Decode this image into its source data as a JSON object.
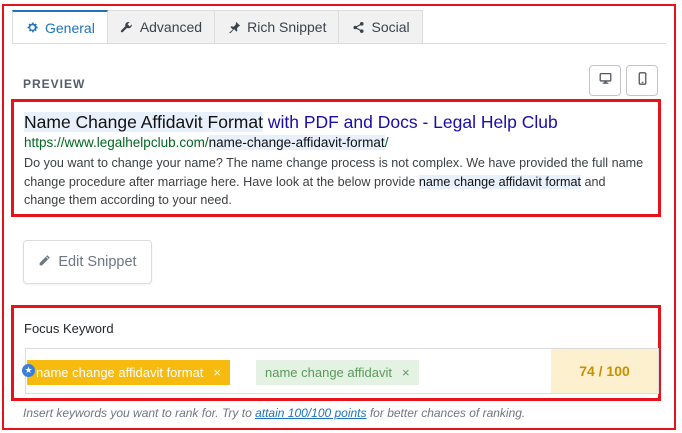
{
  "tabs": [
    {
      "label": "General",
      "icon": "gear-icon",
      "active": true
    },
    {
      "label": "Advanced",
      "icon": "wrench-icon",
      "active": false
    },
    {
      "label": "Rich Snippet",
      "icon": "pin-icon",
      "active": false
    },
    {
      "label": "Social",
      "icon": "share-icon",
      "active": false
    }
  ],
  "preview": {
    "label": "PREVIEW",
    "title_highlight": "Name Change Affidavit Format",
    "title_rest": " with PDF and Docs - Legal Help Club",
    "url_base": "https://www.legalhelpclub.com/",
    "url_slug": "name-change-affidavit-format",
    "url_trailing": "/",
    "desc_before": "Do you want to change your name? The name change process is not complex. We have provided the full name change procedure after marriage here. Have look at the below provide ",
    "desc_keyword": "name change affidavit format",
    "desc_after": " and change them according to your need.",
    "device_buttons": [
      "desktop-icon",
      "mobile-icon"
    ]
  },
  "edit_snippet": {
    "label": "Edit Snippet",
    "icon": "pencil-icon"
  },
  "focus_keyword": {
    "label": "Focus Keyword",
    "keywords": [
      {
        "text": "name change affidavit format",
        "primary": true,
        "remove": "×"
      },
      {
        "text": "name change affidavit",
        "primary": false,
        "remove": "×"
      }
    ],
    "score": "74 / 100"
  },
  "hint": {
    "before": "Insert keywords you want to rank for. Try to ",
    "link": "attain 100/100 points",
    "after": " for better chances of ranking."
  },
  "colors": {
    "accent": "#1e73be",
    "highlight_frame": "#e8121b",
    "primary_keyword": "#f7ba0f",
    "secondary_keyword": "#e4f2e4",
    "score_bg": "#fdf0cf",
    "serp_title": "#1a0dab",
    "serp_url": "#006621"
  }
}
